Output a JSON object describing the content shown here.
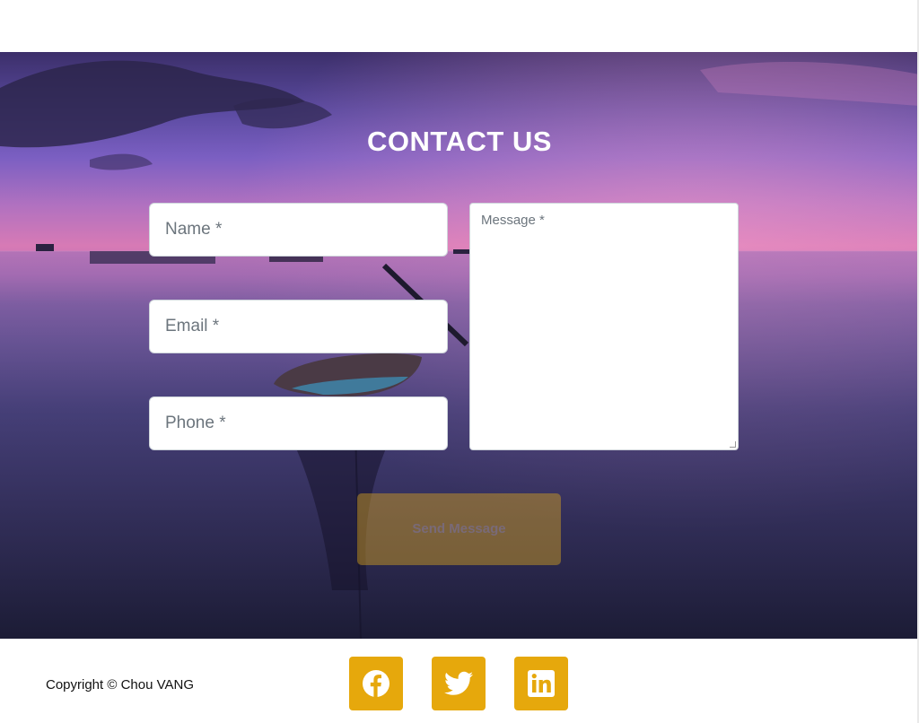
{
  "hero": {
    "title": "CONTACT US"
  },
  "form": {
    "name_placeholder": "Name *",
    "email_placeholder": "Email *",
    "phone_placeholder": "Phone *",
    "message_placeholder": "Message *",
    "send_label": "Send Message"
  },
  "footer": {
    "copyright": "Copyright © Chou VANG",
    "social": [
      {
        "name": "facebook",
        "icon": "facebook-icon"
      },
      {
        "name": "twitter",
        "icon": "twitter-icon"
      },
      {
        "name": "linkedin",
        "icon": "linkedin-icon"
      }
    ]
  },
  "colors": {
    "accent": "#e6a80c",
    "hero_sky_top": "#3c2f6a",
    "hero_sky_glow": "#d77ab5",
    "hero_water": "#1f1f3b"
  }
}
